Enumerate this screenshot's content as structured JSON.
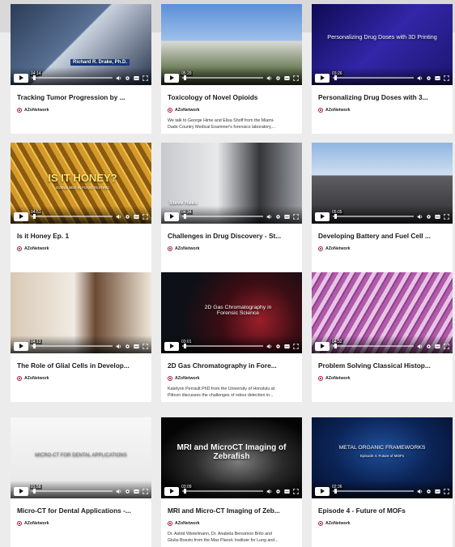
{
  "colors": {
    "page_bg": "#ececec",
    "card_bg": "#ffffff",
    "brand_red": "#c8102e",
    "brand_blue": "#1f3a93"
  },
  "videos": [
    {
      "title": "Tracking Tumor Progression by ...",
      "brand": "AZoNetwork",
      "duration": "04:14",
      "caption": "Richard R. Drake, Ph.D.",
      "progress": 0.02,
      "description": []
    },
    {
      "title": "Toxicology of Novel Opioids",
      "brand": "AZoNetwork",
      "duration": "05:29",
      "caption": "",
      "progress": 0.02,
      "description": [
        "We talk to George Hime and Elisa Shoff from the Miami-",
        "Dade Country Medical Examiner's forensics laboratory,..."
      ]
    },
    {
      "title": "Personalizing Drug Doses with 3...",
      "brand": "AZoNetwork",
      "duration": "03:26",
      "caption": "Personalizing Drug Doses with 3D Printing",
      "progress": 0.02,
      "description": []
    },
    {
      "title": "Is it Honey Ep. 1",
      "brand": "AZoNetwork",
      "duration": "04:51",
      "caption": "IS IT HONEY?",
      "subcaption": "GOING BEE IN FOOD TESTING",
      "progress": 0.02,
      "description": []
    },
    {
      "title": "Challenges in Drug Discovery - St...",
      "brand": "AZoNetwork",
      "duration": "04:34",
      "caption": "Steve Rees",
      "progress": 0.02,
      "description": []
    },
    {
      "title": "Developing Battery and Fuel Cell ...",
      "brand": "AZoNetwork",
      "duration": "05:05",
      "caption": "",
      "progress": 0.02,
      "description": []
    },
    {
      "title": "The Role of Glial Cells in Develop...",
      "brand": "AZoNetwork",
      "duration": "04:13",
      "caption": "",
      "progress": 0.02,
      "description": []
    },
    {
      "title": "2D Gas Chromatography in Fore...",
      "brand": "AZoNetwork",
      "duration": "03:01",
      "caption": "2D Gas Chromatography in Forensic Science",
      "progress": 0.02,
      "description": [
        "Katelynn Perrault PhD from the University of Honolulu at",
        "Pittcon discusses the challenges of odour detection in..."
      ]
    },
    {
      "title": "Problem Solving Classical Histop...",
      "brand": "AZoNetwork",
      "duration": "04:32",
      "caption": "",
      "progress": 0.02,
      "description": []
    },
    {
      "title": "Micro-CT for Dental Applications -...",
      "brand": "AZoNetwork",
      "duration": "01:58",
      "caption": "MICRO-CT FOR DENTAL APPLICATIONS",
      "progress": 0.02,
      "description": []
    },
    {
      "title": "MRI and Micro-CT Imaging of Zeb...",
      "brand": "AZoNetwork",
      "duration": "03:09",
      "caption": "MRI and MicroCT Imaging of Zebrafish",
      "progress": 0.02,
      "description": [
        "Dr. Astrid Wietelmann, Dr. Anabela Bensimon Brito and",
        "Giulia Boezio from the Max Planck Institute for Lung and..."
      ]
    },
    {
      "title": "Episode 4 - Future of MOFs",
      "brand": "AZoNetwork",
      "duration": "02:36",
      "caption": "METAL ORGANIC FRAMEWORKS",
      "subcaption": "Episode 4: Future of MOFs",
      "progress": 0.02,
      "description": []
    }
  ]
}
